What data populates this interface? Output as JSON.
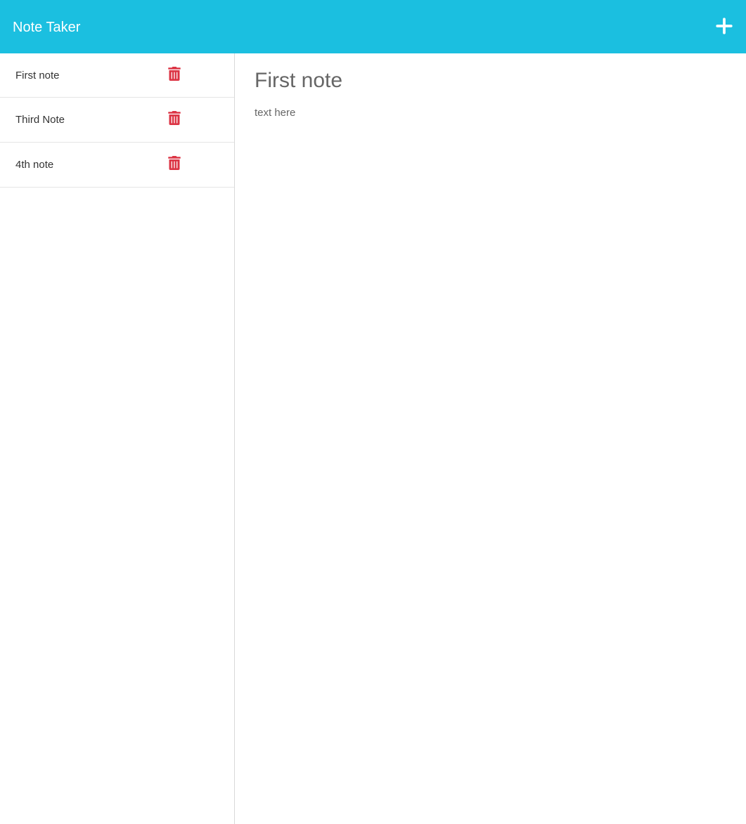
{
  "header": {
    "title": "Note Taker"
  },
  "sidebar": {
    "notes": [
      {
        "title": "First note"
      },
      {
        "title": "Third Note"
      },
      {
        "title": "4th note"
      }
    ]
  },
  "main": {
    "title": "First note",
    "body": "text here"
  },
  "colors": {
    "accent": "#1bbfe0",
    "delete": "#dc3545"
  }
}
